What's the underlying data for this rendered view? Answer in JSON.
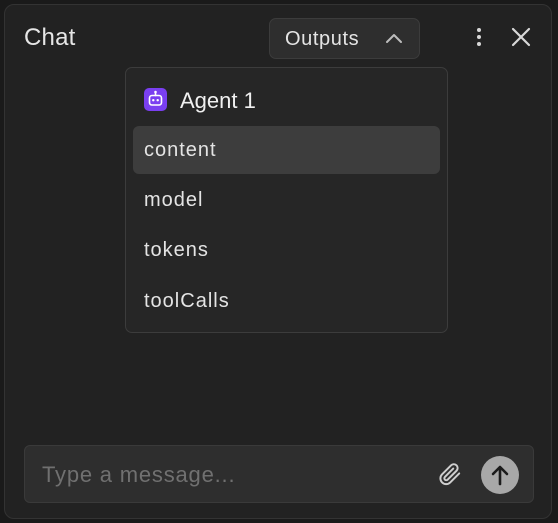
{
  "header": {
    "title": "Chat",
    "outputs_label": "Outputs"
  },
  "dropdown": {
    "agent_name": "Agent 1",
    "options": [
      "content",
      "model",
      "tokens",
      "toolCalls"
    ],
    "selected_index": 0
  },
  "composer": {
    "placeholder": "Type a message..."
  },
  "icons": {
    "outputs_toggle": "chevron-up-icon",
    "menu": "more-vertical-icon",
    "close": "close-icon",
    "agent": "robot-icon",
    "attach": "paperclip-icon",
    "send": "arrow-up-icon"
  },
  "colors": {
    "background": "#1a1a1a",
    "panel": "#222222",
    "agent_accent": "#7a3ff0",
    "selected_option": "#3d3d3d",
    "send_button": "#a8a8a8"
  }
}
